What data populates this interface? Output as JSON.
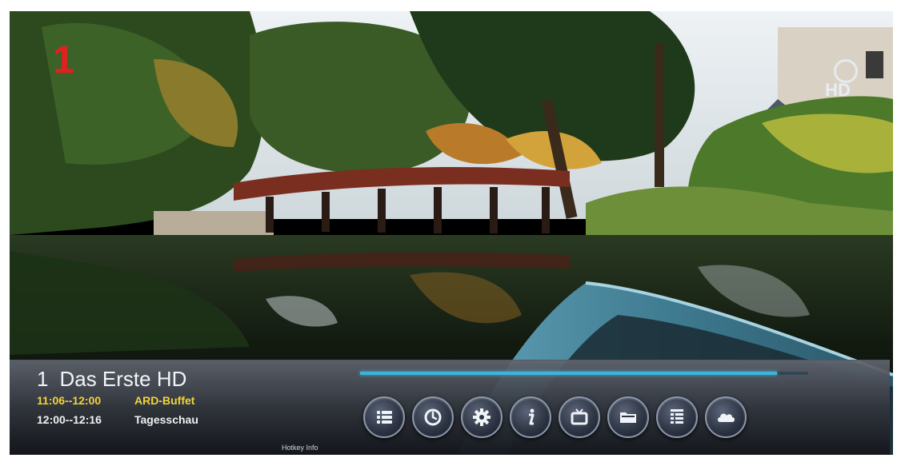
{
  "overlay": {
    "channel_logo": "1",
    "hd_badge": "HD"
  },
  "info_bar": {
    "channel_number": "1",
    "channel_name": "Das Erste HD",
    "now": {
      "time": "11:06--12:00",
      "title": "ARD-Buffet"
    },
    "next": {
      "time": "12:00--12:16",
      "title": "Tagesschau"
    },
    "progress": 0.93,
    "footer": "Hotkey Info"
  },
  "buttons": [
    {
      "name": "channel-list",
      "icon": "list-icon"
    },
    {
      "name": "timer",
      "icon": "clock-icon"
    },
    {
      "name": "settings",
      "icon": "gear-icon"
    },
    {
      "name": "info",
      "icon": "info-icon"
    },
    {
      "name": "tv",
      "icon": "tv-icon"
    },
    {
      "name": "media",
      "icon": "folder-icon"
    },
    {
      "name": "epg",
      "icon": "schedule-list-icon"
    },
    {
      "name": "network",
      "icon": "cloud-icon"
    }
  ],
  "colors": {
    "channel_logo": "#e2201f",
    "now_text": "#f2d43a",
    "progress": "#3fb3d9"
  }
}
